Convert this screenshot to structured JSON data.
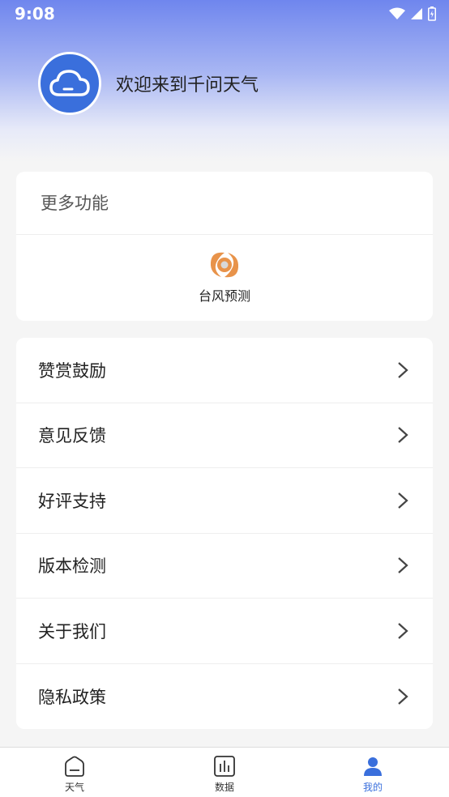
{
  "status_bar": {
    "time": "9:08"
  },
  "profile": {
    "welcome_text": "欢迎来到千问天气",
    "avatar_icon": "cloud-icon"
  },
  "more_features": {
    "title": "更多功能",
    "items": [
      {
        "label": "台风预测",
        "icon": "typhoon-icon",
        "color": "#e8934a"
      }
    ]
  },
  "menu": {
    "items": [
      {
        "label": "赞赏鼓励"
      },
      {
        "label": "意见反馈"
      },
      {
        "label": "好评支持"
      },
      {
        "label": "版本检测"
      },
      {
        "label": "关于我们"
      },
      {
        "label": "隐私政策"
      }
    ]
  },
  "tabbar": {
    "tabs": [
      {
        "label": "天气",
        "icon": "home-icon"
      },
      {
        "label": "数据",
        "icon": "bar-chart-icon"
      },
      {
        "label": "我的",
        "icon": "user-icon",
        "active": true
      }
    ]
  },
  "colors": {
    "accent": "#3a6fdc",
    "header_gradient_top": "#6f86ee"
  }
}
